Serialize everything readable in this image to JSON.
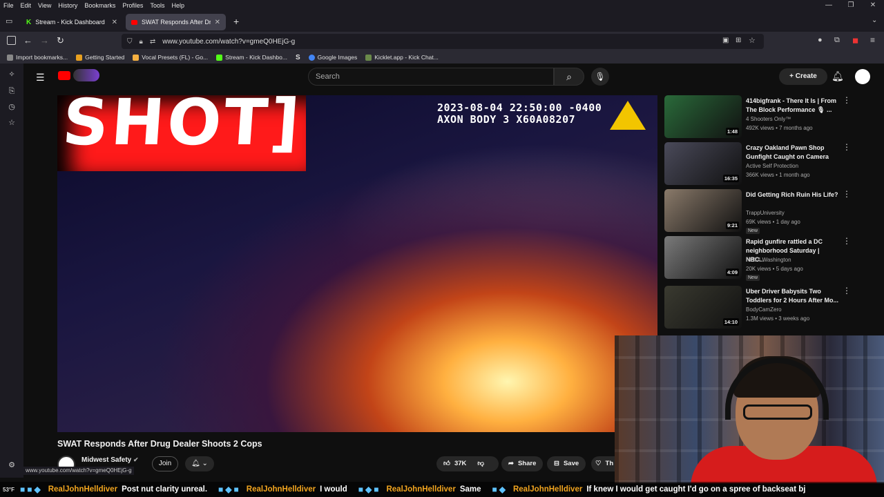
{
  "browser": {
    "menu": [
      "File",
      "Edit",
      "View",
      "History",
      "Bookmarks",
      "Profiles",
      "Tools",
      "Help"
    ],
    "tabs": [
      {
        "label": "Stream - Kick Dashboard",
        "icon": "kick-icon",
        "active": false
      },
      {
        "label": "SWAT Responds After Drug Dea…",
        "icon": "youtube-icon",
        "active": true
      }
    ],
    "new_tab": "+",
    "url": "www.youtube.com/watch?v=gmeQ0HEjG-g",
    "bookmarks": [
      {
        "label": "Import bookmarks...",
        "icon": "import-icon"
      },
      {
        "label": "Getting Started",
        "icon": "firefox-icon"
      },
      {
        "label": "Vocal Presets (FL) - Go...",
        "icon": "folder-icon"
      },
      {
        "label": "Stream - Kick Dashbo...",
        "icon": "kick-icon"
      },
      {
        "label": "",
        "icon": "s-icon"
      },
      {
        "label": "Google Images",
        "icon": "google-icon"
      },
      {
        "label": "Kicklet.app - Kick Chat...",
        "icon": "kicklet-icon"
      }
    ],
    "status_url": "www.youtube.com/watch?v=gmeQ0HEjG-g"
  },
  "youtube": {
    "search_placeholder": "Search",
    "create_label": "Create",
    "video": {
      "overlay_text": "SHOT]",
      "timestamp_line1": "2023-08-04 22:50:00 -0400",
      "timestamp_line2": "AXON BODY 3 X60A08207"
    },
    "title": "SWAT Responds After Drug Dealer Shoots 2 Cops",
    "channel": "Midwest Safety",
    "join_label": "Join",
    "likes": "37K",
    "share_label": "Share",
    "save_label": "Save",
    "thanks_label": "Th",
    "recommendations": [
      {
        "title": "414bigfrank - There It Is | From The Block Performance 🎙 ...",
        "channel": "4 Shooters Only™",
        "meta": "492K views • 7 months ago",
        "duration": "1:48",
        "new": "",
        "thumb": "#2a6a3a"
      },
      {
        "title": "Crazy Oakland Pawn Shop Gunfight Caught on Camera",
        "channel": "Active Self Protection",
        "meta": "366K views • 1 month ago",
        "duration": "16:35",
        "new": "",
        "thumb": "#4a4a5a"
      },
      {
        "title": "Did Getting Rich Ruin His Life?",
        "channel": "TrappUniversity",
        "meta": "69K views • 1 day ago",
        "duration": "9:21",
        "new": "New",
        "thumb": "#8a7a6a"
      },
      {
        "title": "Rapid gunfire rattled a DC neighborhood Saturday | NBC...",
        "channel": "NBC4 Washington",
        "meta": "20K views • 5 days ago",
        "duration": "4:09",
        "new": "New",
        "thumb": "#7a7a7a"
      },
      {
        "title": "Uber Driver Babysits Two Toddlers for 2 Hours After Mo...",
        "channel": "BodyCamZero",
        "meta": "1.3M views • 3 weeks ago",
        "duration": "14:10",
        "new": "",
        "thumb": "#3a3a30"
      }
    ]
  },
  "chat": [
    {
      "user": "RealJohnHelldiver",
      "msg": "Post nut clarity unreal."
    },
    {
      "user": "RealJohnHelldiver",
      "msg": "I would"
    },
    {
      "user": "RealJohnHelldiver",
      "msg": "Same"
    },
    {
      "user": "RealJohnHelldiver",
      "msg": "If knew I would get caught I'd go on a spree of backseat bj"
    }
  ],
  "taskbar": {
    "weather": "53°F"
  }
}
